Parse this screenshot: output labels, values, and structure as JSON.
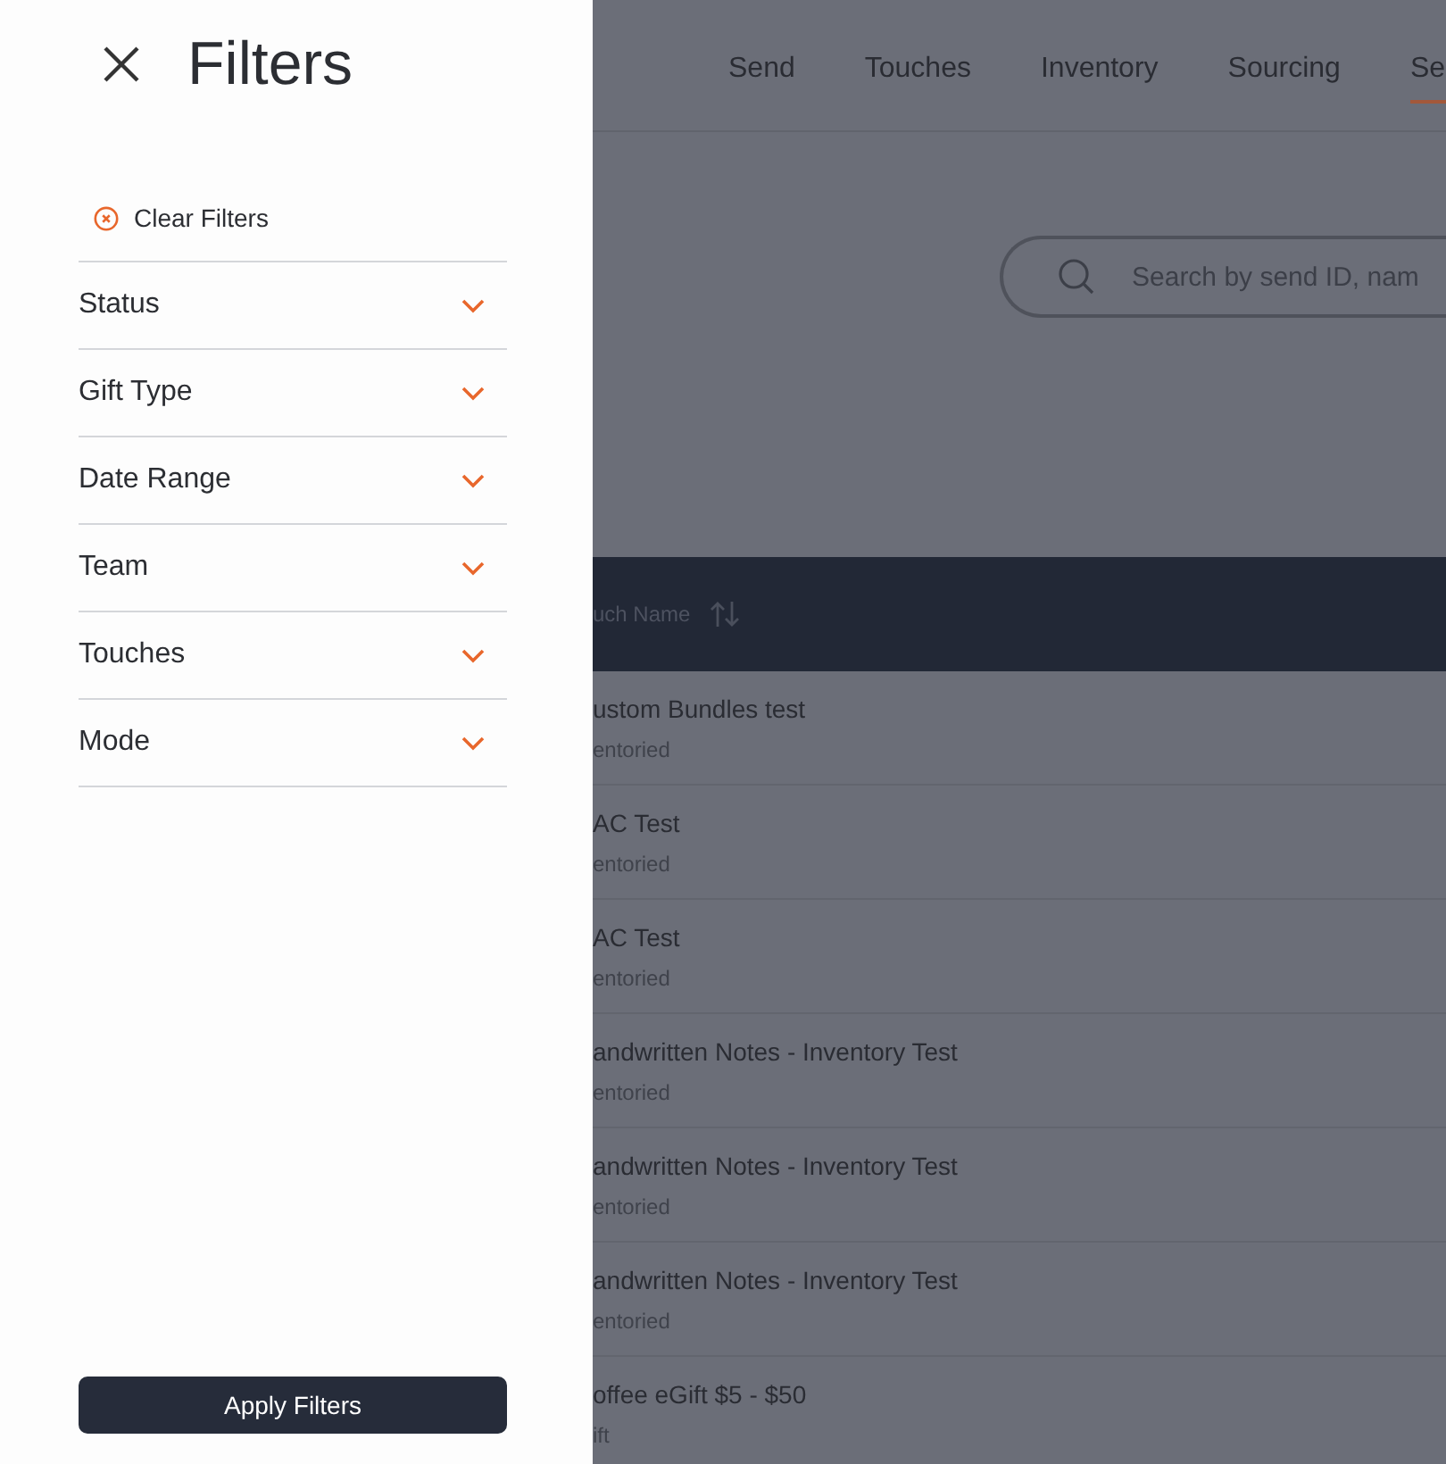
{
  "drawer": {
    "title": "Filters",
    "clear_label": "Clear Filters",
    "filters": [
      {
        "label": "Status",
        "expanded": false
      },
      {
        "label": "Gift Type",
        "expanded": false
      },
      {
        "label": "Date Range",
        "expanded": false
      },
      {
        "label": "Team",
        "expanded": false
      },
      {
        "label": "Touches",
        "expanded": false
      },
      {
        "label": "Mode",
        "expanded": false
      }
    ],
    "apply_label": "Apply Filters"
  },
  "nav_tabs": [
    {
      "label": "Send",
      "selected": false
    },
    {
      "label": "Touches",
      "selected": false
    },
    {
      "label": "Inventory",
      "selected": false
    },
    {
      "label": "Sourcing",
      "selected": false
    },
    {
      "label": "Se",
      "selected": true
    }
  ],
  "search": {
    "placeholder": "Search by send ID, nam"
  },
  "table": {
    "column_header": "uch Name",
    "rows": [
      {
        "name": "ustom Bundles test",
        "subtitle": "entoried"
      },
      {
        "name": "AC Test",
        "subtitle": "entoried"
      },
      {
        "name": "AC Test",
        "subtitle": "entoried"
      },
      {
        "name": "andwritten Notes - Inventory Test",
        "subtitle": "entoried"
      },
      {
        "name": "andwritten Notes - Inventory Test",
        "subtitle": "entoried"
      },
      {
        "name": "andwritten Notes - Inventory Test",
        "subtitle": "entoried"
      },
      {
        "name": "offee eGift $5 - $50",
        "subtitle": "ift"
      }
    ]
  }
}
